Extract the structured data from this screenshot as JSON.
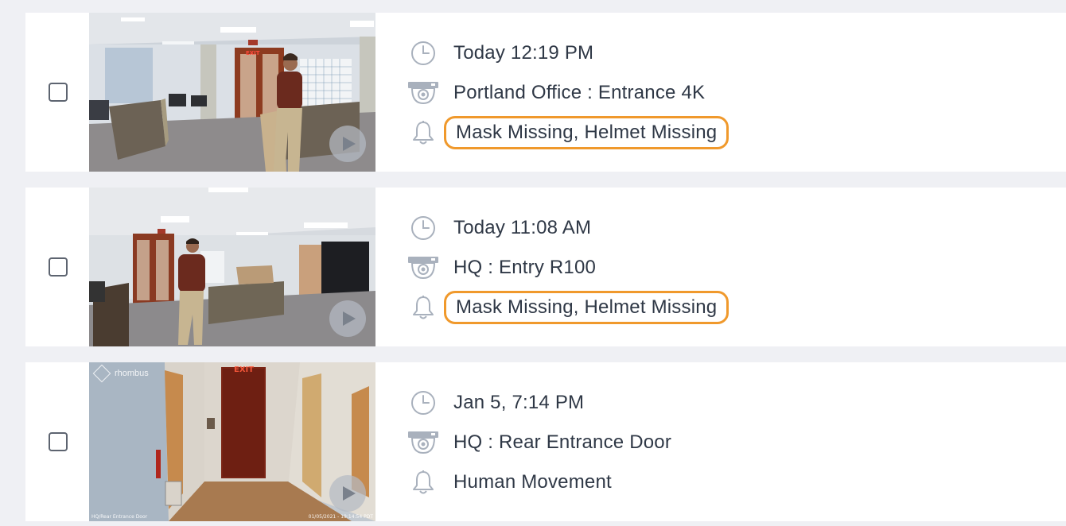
{
  "colors": {
    "alert_outline": "#f0992c",
    "text": "#2f3846",
    "icon": "#a9b1bd",
    "background": "#eff0f4"
  },
  "events": [
    {
      "time": "Today 12:19 PM",
      "camera": "Portland Office : Entrance 4K",
      "alert": "Mask Missing, Helmet Missing",
      "alert_highlighted": true,
      "icons": [
        "clock-icon",
        "camera-icon",
        "bell-icon"
      ]
    },
    {
      "time": "Today 11:08 AM",
      "camera": "HQ : Entry R100",
      "alert": "Mask Missing, Helmet Missing",
      "alert_highlighted": true,
      "icons": [
        "clock-icon",
        "camera-icon",
        "bell-icon"
      ]
    },
    {
      "time": "Jan 5, 7:14 PM",
      "camera": "HQ : Rear Entrance Door",
      "alert": "Human Movement",
      "alert_highlighted": false,
      "icons": [
        "clock-icon",
        "camera-icon",
        "bell-icon"
      ],
      "thumbnail_overlay": {
        "brand": "rhombus",
        "camera_label": "HQ/Rear Entrance Door",
        "timestamp": "01/05/2021 - 19:14:54 PDT",
        "sign": "EXIT"
      }
    }
  ],
  "thumbnail_signs": {
    "row1": "EXIT"
  }
}
